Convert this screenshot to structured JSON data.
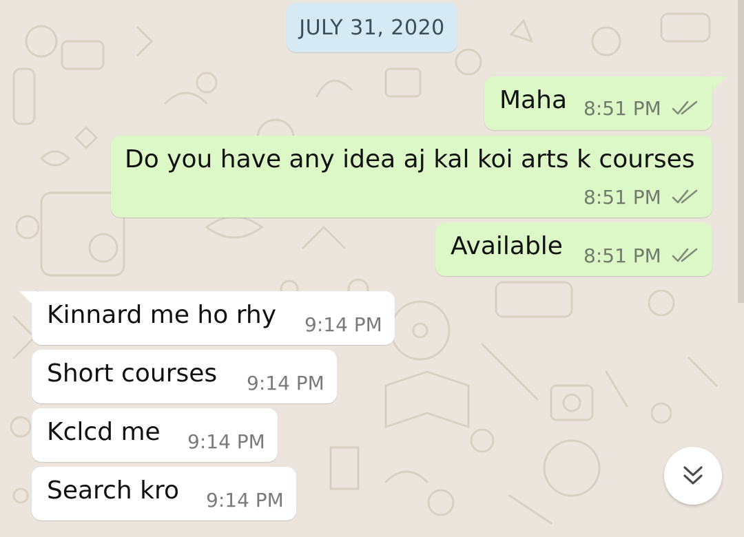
{
  "date_divider": "JULY 31, 2020",
  "messages": [
    {
      "direction": "outgoing",
      "text": "Maha",
      "time": "8:51 PM",
      "status": "read"
    },
    {
      "direction": "outgoing",
      "text": "Do you have any idea aj kal koi arts k courses",
      "time": "8:51 PM",
      "status": "read"
    },
    {
      "direction": "outgoing",
      "text": "Available",
      "time": "8:51 PM",
      "status": "read"
    },
    {
      "direction": "incoming",
      "text": "Kinnard me ho rhy",
      "time": "9:14 PM"
    },
    {
      "direction": "incoming",
      "text": "Short courses",
      "time": "9:14 PM"
    },
    {
      "direction": "incoming",
      "text": "Kclcd me",
      "time": "9:14 PM"
    },
    {
      "direction": "incoming",
      "text": "Search kro",
      "time": "9:14 PM"
    }
  ],
  "icons": {
    "read_receipt": "double-check-icon",
    "scroll_down": "double-chevron-down-icon"
  },
  "colors": {
    "wallpaper": "#ece5dd",
    "outgoing_bubble": "#dcf8c6",
    "incoming_bubble": "#ffffff",
    "date_chip": "#d5eaf4",
    "read_ticks": "#7f8b78"
  }
}
